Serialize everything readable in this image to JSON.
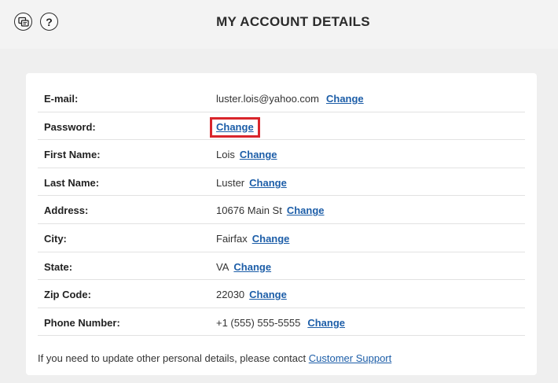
{
  "header": {
    "title": "MY ACCOUNT DETAILS",
    "help_glyph": "?"
  },
  "details": {
    "rows": [
      {
        "label": "E-mail:",
        "value": "luster.lois@yahoo.com",
        "action": "Change"
      },
      {
        "label": "Password:",
        "value": "",
        "action": "Change"
      },
      {
        "label": "First Name:",
        "value": "Lois",
        "action": "Change"
      },
      {
        "label": "Last Name:",
        "value": "Luster",
        "action": "Change"
      },
      {
        "label": "Address:",
        "value": "10676 Main St",
        "action": "Change"
      },
      {
        "label": "City:",
        "value": "Fairfax",
        "action": "Change"
      },
      {
        "label": "State:",
        "value": "VA",
        "action": "Change"
      },
      {
        "label": "Zip Code:",
        "value": "22030",
        "action": "Change"
      },
      {
        "label": "Phone Number:",
        "value": "+1 (555) 555-5555",
        "action": "Change"
      }
    ]
  },
  "footer": {
    "note": "If you need to update other personal details, please contact ",
    "support_link": "Customer Support"
  },
  "colors": {
    "link": "#1d5ea8",
    "highlight": "#d9262c",
    "background": "#efefef"
  }
}
